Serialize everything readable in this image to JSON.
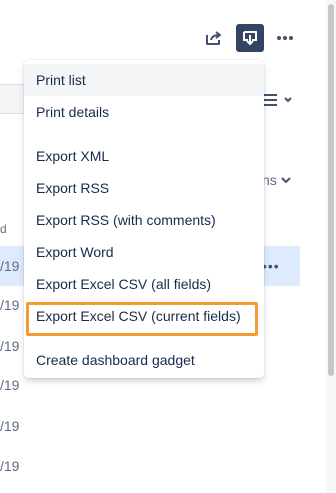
{
  "toolbar": {
    "share_icon": "share-icon",
    "export_icon": "export-download-icon",
    "more_icon": "more-horizontal-icon"
  },
  "background": {
    "columns_label": "ns",
    "column_header_fragment": "d",
    "row_dots": "•••",
    "dates": [
      "/19",
      "/19",
      "/19",
      "/19",
      "/19",
      "/19"
    ]
  },
  "menu": {
    "items": [
      {
        "label": "Print list"
      },
      {
        "label": "Print details"
      },
      {
        "label": "Export XML"
      },
      {
        "label": "Export RSS"
      },
      {
        "label": "Export RSS (with comments)"
      },
      {
        "label": "Export Word"
      },
      {
        "label": "Export Excel CSV (all fields)"
      },
      {
        "label": "Export Excel CSV (current fields)"
      },
      {
        "label": "Create dashboard gadget"
      }
    ]
  },
  "colors": {
    "accent_highlight": "#f39c33",
    "export_button_bg": "#344563",
    "selected_row_bg": "#deebff"
  }
}
